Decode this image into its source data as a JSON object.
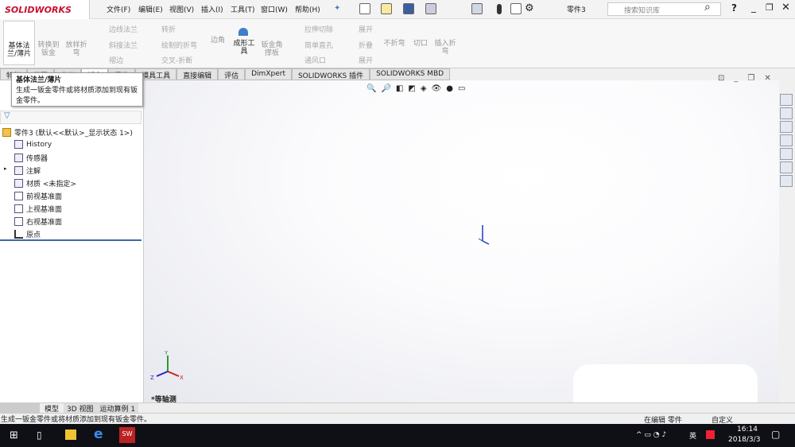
{
  "app": {
    "logo": "SOLIDWORKS",
    "doc_title": "零件3",
    "search_placeholder": "搜索知识库"
  },
  "menu": [
    "文件(F)",
    "编辑(E)",
    "视图(V)",
    "插入(I)",
    "工具(T)",
    "窗口(W)",
    "帮助(H)"
  ],
  "ribbon": {
    "large": [
      {
        "label": "基体法兰/薄片",
        "state": "active"
      },
      {
        "label": "转换到钣金"
      },
      {
        "label": "放样折弯"
      },
      {
        "label": "边角"
      },
      {
        "label": "成形工具",
        "state": "active"
      },
      {
        "label": "钣金角撑板"
      },
      {
        "label": "不折弯"
      },
      {
        "label": "切口"
      },
      {
        "label": "插入折弯"
      }
    ],
    "small": [
      "边线法兰",
      "斜接法兰",
      "褶边",
      "转折",
      "绘制的折弯",
      "交叉-折断",
      "拉伸切除",
      "简单直孔",
      "通风口",
      "展开",
      "折叠",
      "展开"
    ]
  },
  "tabs": [
    "特征",
    "草图",
    "曲面",
    "钣金",
    "零件",
    "模具工具",
    "直接编辑",
    "评估",
    "DimXpert",
    "SOLIDWORKS 插件",
    "SOLIDWORKS MBD"
  ],
  "tooltip": {
    "title": "基体法兰/薄片",
    "body": "生成一钣金零件或将材质添加到现有钣金零件。"
  },
  "tree": {
    "root": "零件3  (默认<<默认>_显示状态 1>)",
    "items": [
      "History",
      "传感器",
      "注解",
      "材质 <未指定>",
      "前视基准面",
      "上视基准面",
      "右视基准面",
      "原点"
    ]
  },
  "viewport": {
    "view_label": "*等轴测",
    "axes": [
      "X",
      "Y",
      "Z"
    ]
  },
  "bottom_tabs": [
    "模型",
    "3D 视图",
    "运动算例 1"
  ],
  "status": {
    "message": "生成一钣金零件或将材质添加到现有钣金零件。",
    "editing": "在编辑 零件",
    "custom": "自定义"
  },
  "taskbar": {
    "time": "16:14",
    "date": "2018/3/3",
    "ime": "英",
    "sw_label": "SW"
  }
}
